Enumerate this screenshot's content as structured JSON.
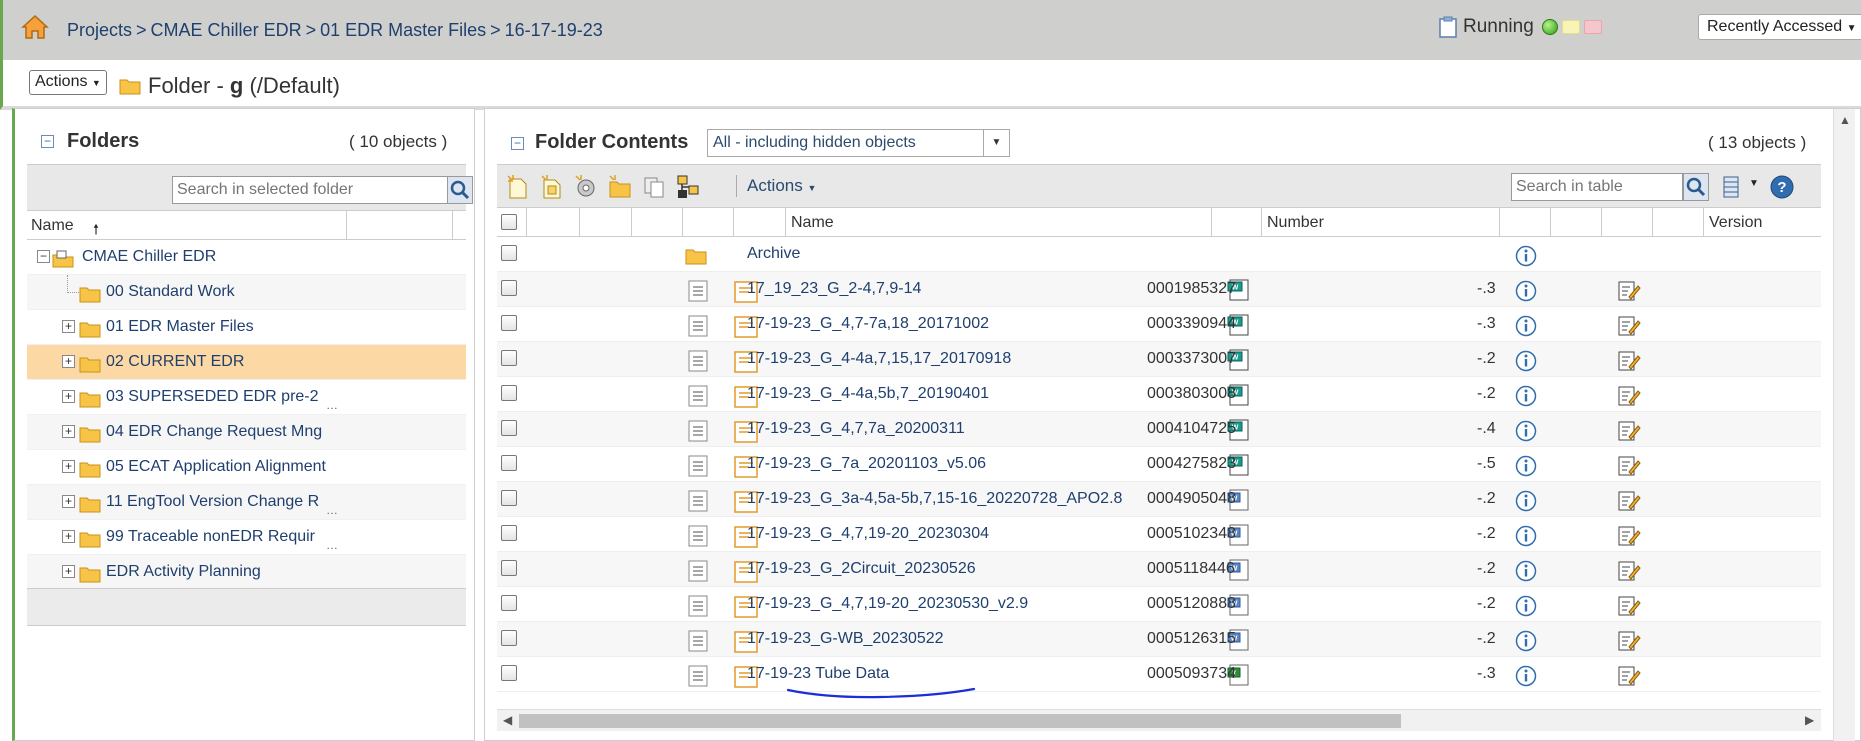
{
  "breadcrumb": {
    "items": [
      "Projects",
      "CMAE Chiller EDR",
      "01 EDR Master Files",
      "16-17-19-23"
    ],
    "separator": ">"
  },
  "status": {
    "label": "Running"
  },
  "recently_accessed": {
    "label": "Recently Accessed"
  },
  "title": {
    "actions_label": "Actions",
    "prefix": "Folder - ",
    "name": "g",
    "suffix": " (/Default)"
  },
  "folders_panel": {
    "title": "Folders",
    "count": "( 10 objects )",
    "search_placeholder": "Search in selected folder",
    "column_name": "Name",
    "tree": [
      {
        "label": "CMAE Chiller EDR",
        "expander": "minus",
        "level": 0
      },
      {
        "label": "00 Standard Work",
        "expander": "",
        "level": 1
      },
      {
        "label": "01 EDR Master Files",
        "expander": "plus",
        "level": 1
      },
      {
        "label": "02 CURRENT EDR",
        "expander": "plus",
        "level": 1,
        "selected": true
      },
      {
        "label": "03 SUPERSEDED EDR pre-2",
        "expander": "plus",
        "level": 1,
        "truncated": true
      },
      {
        "label": "04 EDR Change Request Mng",
        "expander": "plus",
        "level": 1
      },
      {
        "label": "05 ECAT Application Alignment",
        "expander": "plus",
        "level": 1
      },
      {
        "label": "11 EngTool Version Change R",
        "expander": "plus",
        "level": 1,
        "truncated": true
      },
      {
        "label": "99 Traceable nonEDR Requir",
        "expander": "plus",
        "level": 1,
        "truncated": true
      },
      {
        "label": "EDR Activity Planning",
        "expander": "plus",
        "level": 1
      }
    ]
  },
  "contents_panel": {
    "title": "Folder Contents",
    "filter_value": "All - including hidden objects",
    "count": "( 13 objects )",
    "toolbar_actions": "Actions",
    "search_placeholder": "Search in table",
    "columns": {
      "name": "Name",
      "number": "Number",
      "version": "Version"
    },
    "rows": [
      {
        "name": "Archive",
        "type": "folder",
        "number": "",
        "version": ""
      },
      {
        "name": "17_19_23_G_2-4,7,9-14",
        "type": "edr",
        "number": "0001985327",
        "version": "-.3"
      },
      {
        "name": "17-19-23_G_4,7-7a,18_20171002",
        "type": "edr",
        "number": "0003390944",
        "version": "-.3"
      },
      {
        "name": "17-19-23_G_4-4a,7,15,17_20170918",
        "type": "edr",
        "number": "0003373007",
        "version": "-.2"
      },
      {
        "name": "17-19-23_G_4-4a,5b,7_20190401",
        "type": "edr",
        "number": "0003803008",
        "version": "-.2"
      },
      {
        "name": "17-19-23_G_4,7,7a_20200311",
        "type": "edr",
        "number": "0004104725",
        "version": "-.4"
      },
      {
        "name": "17-19-23_G_7a_20201103_v5.06",
        "type": "edr",
        "number": "0004275823",
        "version": "-.5"
      },
      {
        "name": "17-19-23_G_3a-4,5a-5b,7,15-16_20220728_APO2.8",
        "type": "doc",
        "number": "0004905048",
        "version": "-.2"
      },
      {
        "name": "17-19-23_G_4,7,19-20_20230304",
        "type": "doc",
        "number": "0005102348",
        "version": "-.2"
      },
      {
        "name": "17-19-23_G_2Circuit_20230526",
        "type": "doc",
        "number": "0005118446",
        "version": "-.2"
      },
      {
        "name": "17-19-23_G_4,7,19-20_20230530_v2.9",
        "type": "doc",
        "number": "0005120888",
        "version": "-.2"
      },
      {
        "name": "17-19-23_G-WB_20230522",
        "type": "doc",
        "number": "0005126315",
        "version": "-.2"
      },
      {
        "name": "17-19-23 Tube Data",
        "type": "excel",
        "number": "0005093734",
        "version": "-.3"
      }
    ]
  },
  "colors": {
    "link": "#1f3f6e",
    "selected_row": "#fbd8a4",
    "top_bar": "#cfd0cd",
    "annotation_stroke": "#1a2fd6"
  }
}
